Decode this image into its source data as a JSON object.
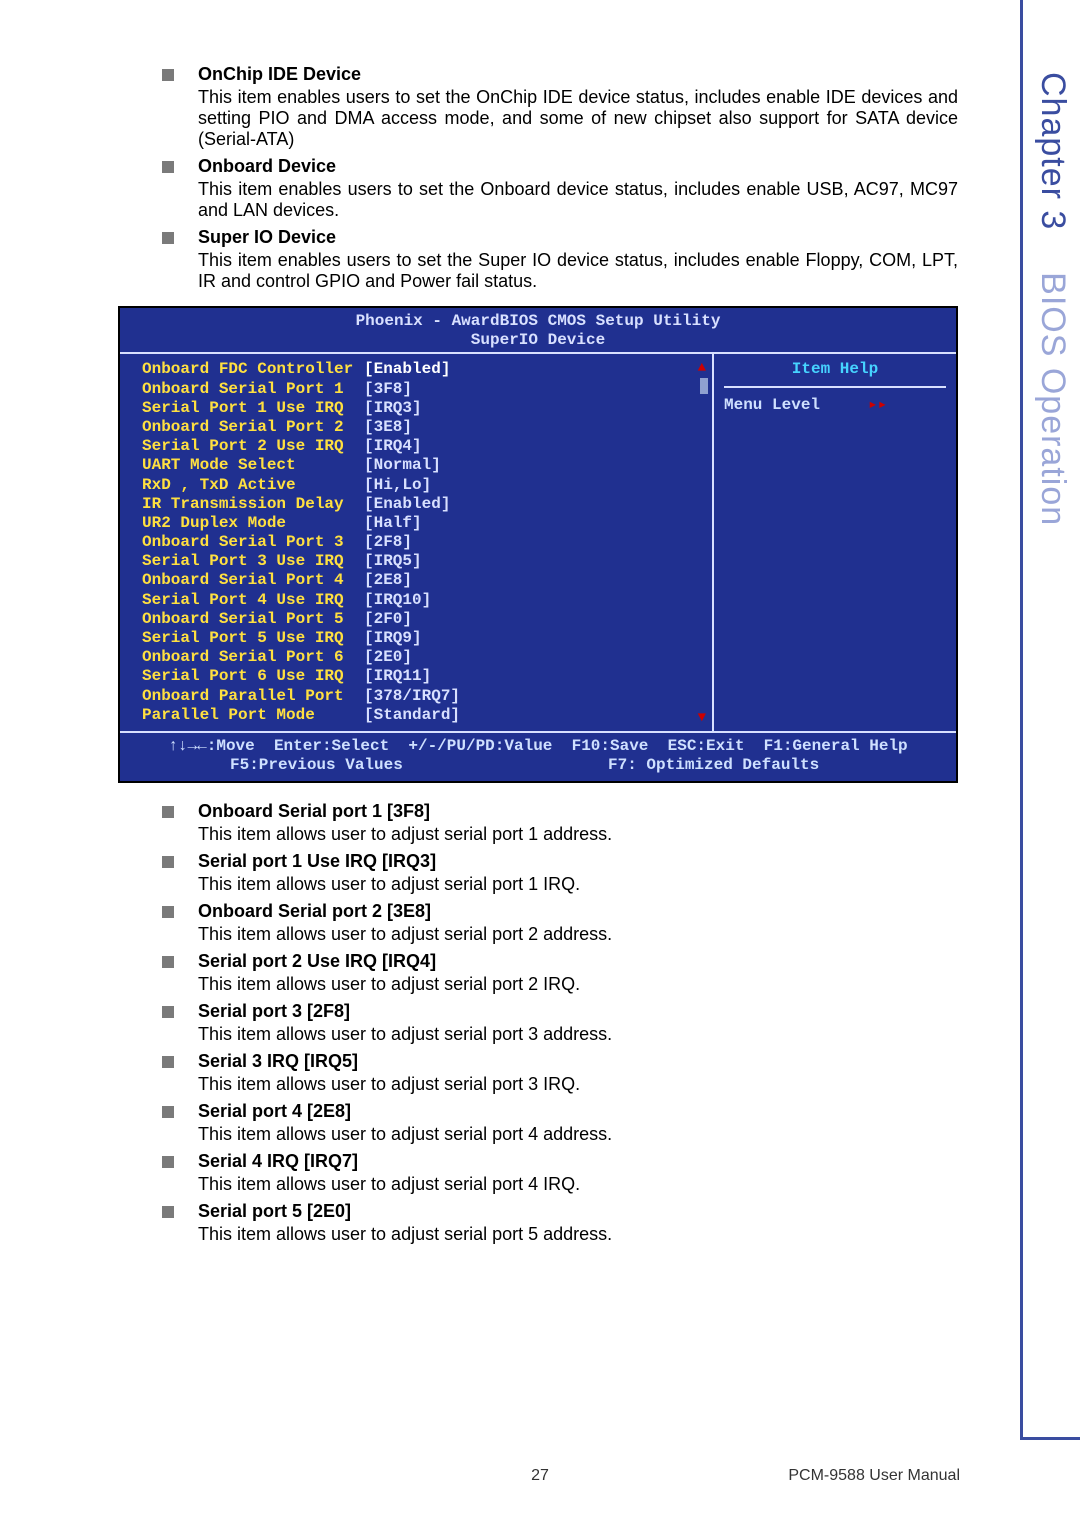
{
  "side": {
    "chapter": "Chapter 3",
    "title": "BIOS Operation"
  },
  "intro": [
    {
      "title": "OnChip IDE Device",
      "desc": "This item enables users to set the OnChip IDE device status, includes enable IDE devices and setting PIO and DMA access mode, and some of new chipset also support for SATA device (Serial-ATA)"
    },
    {
      "title": "Onboard Device",
      "desc": "This item enables users to set the Onboard device status, includes enable USB, AC97, MC97 and LAN devices."
    },
    {
      "title": "Super IO Device",
      "desc": "This item enables users to set the Super IO device status, includes enable Floppy, COM, LPT, IR and control GPIO and Power fail status."
    }
  ],
  "bios": {
    "title1": "Phoenix - AwardBIOS CMOS Setup Utility",
    "title2": "SuperIO Device",
    "rows": [
      {
        "label": "Onboard FDC Controller",
        "val": "[Enabled]",
        "selected": true
      },
      {
        "label": "Onboard Serial Port 1",
        "val": "[3F8]"
      },
      {
        "label": "Serial Port 1 Use IRQ",
        "val": "[IRQ3]"
      },
      {
        "label": "Onboard Serial Port 2",
        "val": "[3E8]"
      },
      {
        "label": "Serial Port 2 Use IRQ",
        "val": "[IRQ4]"
      },
      {
        "label": "UART Mode Select",
        "val": "[Normal]"
      },
      {
        "label": "RxD , TxD Active",
        "val": "[Hi,Lo]"
      },
      {
        "label": "IR Transmission Delay",
        "val": "[Enabled]"
      },
      {
        "label": "UR2 Duplex Mode",
        "val": "[Half]"
      },
      {
        "label": "Onboard Serial Port 3",
        "val": "[2F8]"
      },
      {
        "label": "Serial Port 3 Use IRQ",
        "val": "[IRQ5]"
      },
      {
        "label": "Onboard Serial Port 4",
        "val": "[2E8]"
      },
      {
        "label": "Serial Port 4 Use IRQ",
        "val": "[IRQ10]"
      },
      {
        "label": "Onboard Serial Port 5",
        "val": "[2F0]"
      },
      {
        "label": "Serial Port 5 Use IRQ",
        "val": "[IRQ9]"
      },
      {
        "label": "Onboard Serial Port 6",
        "val": "[2E0]"
      },
      {
        "label": "Serial Port 6 Use IRQ",
        "val": "[IRQ11]"
      },
      {
        "label": "Onboard Parallel Port",
        "val": "[378/IRQ7]"
      },
      {
        "label": "Parallel Port Mode",
        "val": "[Standard]"
      }
    ],
    "help_title": "Item Help",
    "menu_level": "Menu Level",
    "footer_l1a": "↑↓→←:Move  Enter:Select  +/-/PU/PD:Value  F10:Save  ESC:Exit  F1:General Help",
    "footer_l2a": "F5:Previous Values",
    "footer_l2b": "F7: Optimized Defaults"
  },
  "items": [
    {
      "title": "Onboard Serial port 1 [3F8]",
      "desc": "This item allows user to adjust serial port 1 address."
    },
    {
      "title": "Serial port 1 Use IRQ [IRQ3]",
      "desc": "This item allows user to adjust serial port 1 IRQ."
    },
    {
      "title": "Onboard Serial port 2 [3E8]",
      "desc": "This item allows user to adjust serial port 2 address."
    },
    {
      "title": "Serial port 2 Use IRQ [IRQ4]",
      "desc": "This item allows user to adjust serial port 2 IRQ."
    },
    {
      "title": "Serial port 3 [2F8]",
      "desc": "This item allows user to adjust serial port 3 address."
    },
    {
      "title": "Serial 3 IRQ [IRQ5]",
      "desc": "This item allows user to adjust serial port 3 IRQ."
    },
    {
      "title": "Serial port 4 [2E8]",
      "desc": "This item allows user to adjust serial port 4 address."
    },
    {
      "title": "Serial 4 IRQ [IRQ7]",
      "desc": "This item allows user to adjust serial port 4 IRQ."
    },
    {
      "title": "Serial port 5 [2E0]",
      "desc": "This item allows user to adjust serial port 5 address."
    }
  ],
  "footer": {
    "page": "27",
    "title": "PCM-9588 User Manual"
  }
}
